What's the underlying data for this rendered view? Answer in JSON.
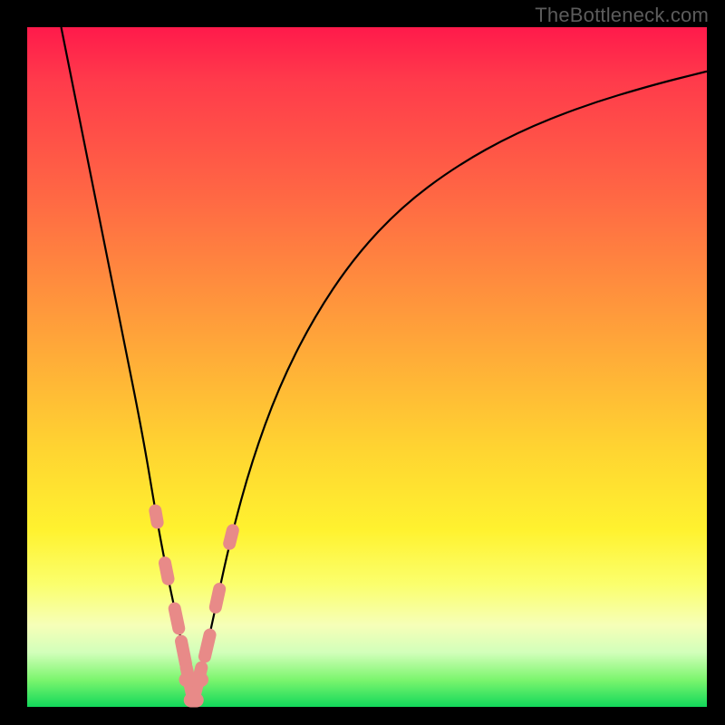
{
  "watermark": "TheBottleneck.com",
  "chart_data": {
    "type": "line",
    "title": "",
    "xlabel": "",
    "ylabel": "",
    "xlim": [
      0,
      100
    ],
    "ylim": [
      0,
      100
    ],
    "grid": false,
    "legend": false,
    "series": [
      {
        "name": "bottleneck-curve",
        "x": [
          5,
          8,
          11,
          14,
          17,
          19,
          20.5,
          22,
          23,
          23.8,
          24.5,
          25.2,
          26.5,
          28,
          30,
          33,
          37,
          42,
          48,
          55,
          63,
          72,
          82,
          92,
          100
        ],
        "y": [
          100,
          85,
          70,
          55,
          40,
          28,
          20,
          13,
          8,
          4,
          1,
          4,
          9,
          16,
          25,
          36,
          47,
          57,
          66,
          73.5,
          79.5,
          84.5,
          88.5,
          91.5,
          93.5
        ]
      }
    ],
    "highlight_segments": [
      {
        "on": "left-branch",
        "approx_y_range": [
          6,
          30
        ]
      },
      {
        "on": "right-branch",
        "approx_y_range": [
          6,
          28
        ]
      },
      {
        "on": "trough",
        "approx_y_range": [
          0,
          6
        ]
      }
    ],
    "colors": {
      "curve": "#000000",
      "highlight": "#e88a88",
      "background_top": "#ff1a4b",
      "background_bottom": "#12d85a"
    }
  }
}
